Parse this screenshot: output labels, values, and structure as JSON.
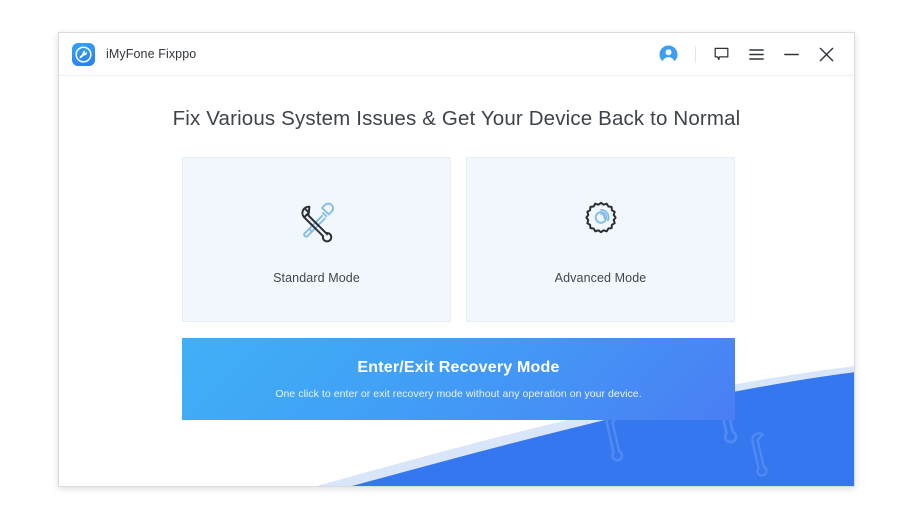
{
  "window": {
    "titlebar": {
      "app_name": "iMyFone Fixppo",
      "logo_icon": "wrench-badge-icon",
      "controls": [
        {
          "name": "account-avatar",
          "icon": "user-avatar-icon",
          "label": ""
        },
        {
          "name": "feedback-button",
          "icon": "chat-bubble-icon",
          "label": ""
        },
        {
          "name": "menu-button",
          "icon": "hamburger-menu-icon",
          "label": ""
        },
        {
          "name": "minimize-button",
          "icon": "minimize-icon",
          "label": ""
        },
        {
          "name": "close-button",
          "icon": "close-icon",
          "label": ""
        }
      ]
    },
    "main": {
      "headline": "Fix Various System Issues & Get Your Device Back to Normal",
      "modes": [
        {
          "label": "Standard Mode",
          "icon": "wrench-screwdriver-icon"
        },
        {
          "label": "Advanced Mode",
          "icon": "gear-icon"
        }
      ],
      "cta": {
        "title": "Enter/Exit Recovery Mode",
        "subtitle": "One click to enter or exit recovery mode without any operation on your device."
      }
    }
  },
  "colors": {
    "brand_blue": "#2a7ef0",
    "cta_gradient_start": "#3fb0f7",
    "cta_gradient_end": "#4a7ef4",
    "card_background": "#f1f7fd",
    "wave_blue": "#3577ef",
    "wave_light": "#cddff8",
    "icon_dark": "#2d3238",
    "icon_accent": "#7fbbe8",
    "heading_text": "#3e444b"
  }
}
